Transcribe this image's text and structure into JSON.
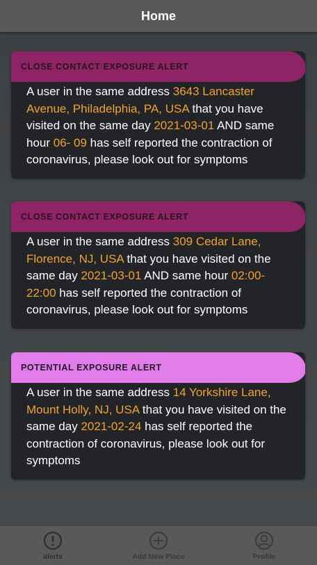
{
  "header": {
    "title": "Home"
  },
  "alerts": [
    {
      "type": "close",
      "title": "CLOSE CONTACT EXPOSURE ALERT",
      "parts": [
        {
          "text": "A user in the same address ",
          "hl": false
        },
        {
          "text": "3643 Lancaster Avenue, Philadelphia, PA, USA",
          "hl": true
        },
        {
          "text": " that you have visited on the same day ",
          "hl": false
        },
        {
          "text": "2021-03-01",
          "hl": true
        },
        {
          "text": " AND same hour ",
          "hl": false
        },
        {
          "text": "06- 09",
          "hl": true
        },
        {
          "text": " has self reported the contraction of coronavirus, please look out for symptoms",
          "hl": false
        }
      ]
    },
    {
      "type": "close",
      "title": "CLOSE CONTACT EXPOSURE ALERT",
      "parts": [
        {
          "text": "A user in the same address ",
          "hl": false
        },
        {
          "text": "309 Cedar Lane, Florence, NJ, USA",
          "hl": true
        },
        {
          "text": " that you have visited on the same day ",
          "hl": false
        },
        {
          "text": "2021-03-01",
          "hl": true
        },
        {
          "text": " AND same hour ",
          "hl": false
        },
        {
          "text": "02:00-22:00",
          "hl": true
        },
        {
          "text": " has self reported the contraction of coronavirus, please look out for symptoms",
          "hl": false
        }
      ]
    },
    {
      "type": "potential",
      "title": "POTENTIAL EXPOSURE ALERT",
      "parts": [
        {
          "text": "A user in the same address ",
          "hl": false
        },
        {
          "text": "14 Yorkshire Lane, Mount Holly, NJ, USA",
          "hl": true
        },
        {
          "text": " that you have visited on the same day ",
          "hl": false
        },
        {
          "text": "2021-02-24",
          "hl": true
        },
        {
          "text": " has self reported the contraction of coronavirus, please look out for symptoms",
          "hl": false
        }
      ]
    }
  ],
  "tabs": [
    {
      "label": "alerts",
      "icon": "alert-circle-icon",
      "active": true
    },
    {
      "label": "Add New Place",
      "icon": "add-circle-icon",
      "active": false
    },
    {
      "label": "Profile",
      "icon": "profile-icon",
      "active": false
    }
  ],
  "colors": {
    "highlight": "#f0a330",
    "close_alert": "#8e2366",
    "potential_alert": "#e17ce9",
    "card_bg": "#232427",
    "bar_bg": "#5a5957"
  }
}
